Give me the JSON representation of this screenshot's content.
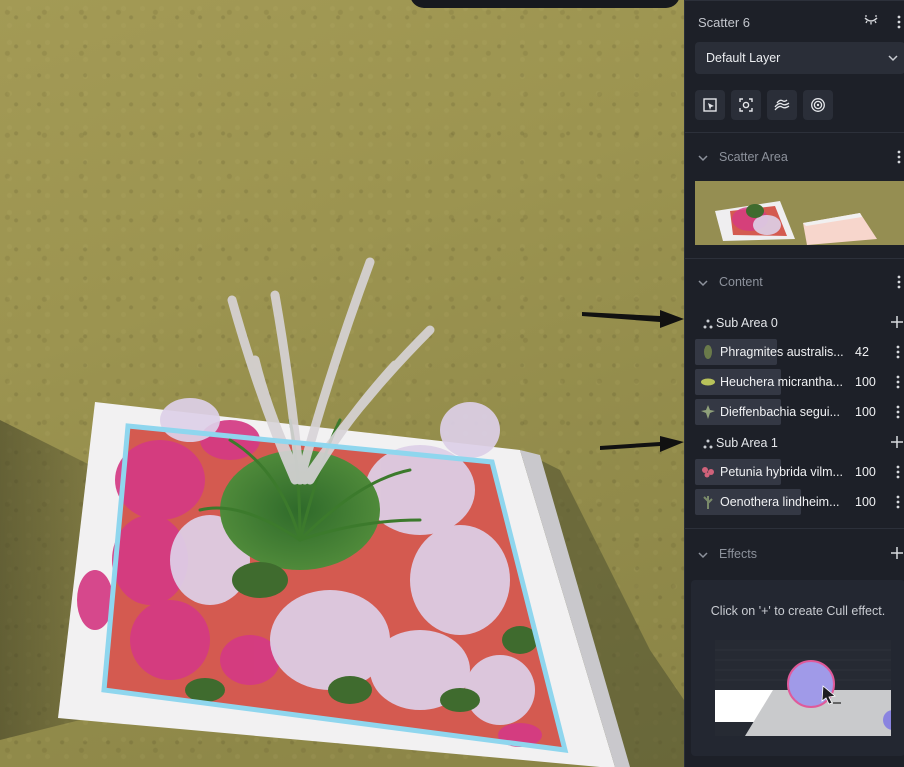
{
  "panel": {
    "title": "Scatter 6",
    "layer_dropdown": "Default Layer",
    "tools": [
      "select-area-icon",
      "focus-frame-icon",
      "terrain-icon",
      "target-icon"
    ],
    "sections": {
      "scatter_area": {
        "title": "Scatter Area"
      },
      "content": {
        "title": "Content",
        "sub_areas": [
          {
            "label": "Sub Area 0",
            "items": [
              {
                "name": "Phragmites australis...",
                "count": "42",
                "color": "#6a7a4a",
                "fill": 0.42
              },
              {
                "name": "Heuchera micrantha...",
                "count": "100",
                "color": "#b8c25a",
                "fill": 0.44
              },
              {
                "name": "Dieffenbachia segui...",
                "count": "100",
                "color": "#8fa07a",
                "fill": 0.44
              }
            ]
          },
          {
            "label": "Sub Area 1",
            "items": [
              {
                "name": "Petunia hybrida vilm...",
                "count": "100",
                "color": "#d0627a",
                "fill": 0.44
              },
              {
                "name": "Oenothera lindheim...",
                "count": "100",
                "color": "#7a8a6a",
                "fill": 0.54
              }
            ]
          }
        ]
      },
      "effects": {
        "title": "Effects",
        "hint": "Click on '+' to create Cull effect."
      }
    }
  },
  "colors": {
    "panel_bg": "#1d2028",
    "selection_outline": "#8fd6ee",
    "bed_red": "#d45a50",
    "ground": "#9c9450"
  }
}
